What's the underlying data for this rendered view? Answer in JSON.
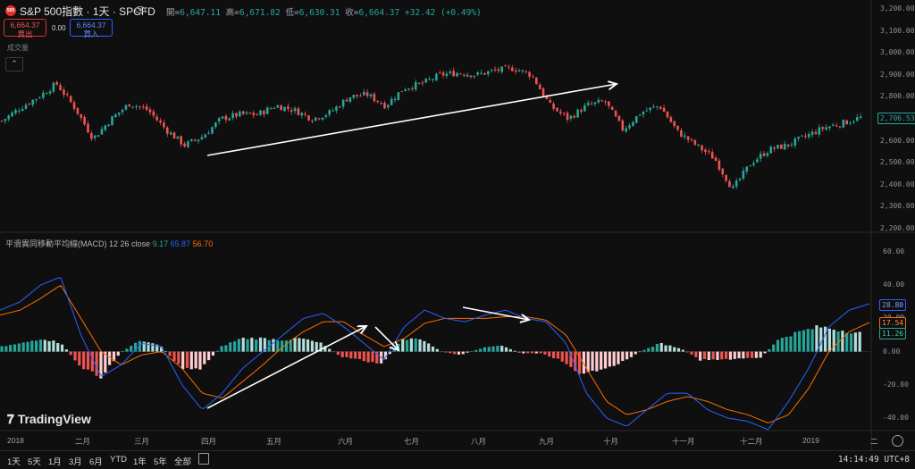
{
  "header": {
    "symbol_badge": "500",
    "title": "S&P 500指數 · 1天 · SPCFD",
    "open_label": "開=",
    "open": "6,647.11",
    "high_label": "高=",
    "high": "6,671.82",
    "low_label": "低=",
    "low": "6,630.31",
    "close_label": "收=",
    "close": "6,664.37",
    "change": "+32.42 (+0.49%)",
    "eye_icon": "eye-icon"
  },
  "trade": {
    "sell_price": "6,664.37",
    "sell_label": "賣出",
    "spread": "0.00",
    "buy_price": "6,664.37",
    "buy_label": "買入"
  },
  "volume_label": "成交量",
  "collapse_icon": "chevron-up-icon",
  "macd": {
    "title": "平滑異同移動平均線(MACD)",
    "params": "12 26 close",
    "hist_value": "9.17",
    "macd_value": "65.87",
    "signal_value": "56.70"
  },
  "price_axis": [
    "3,200.00",
    "3,100.00",
    "3,000.00",
    "2,900.00",
    "2,800.00",
    "2,700.00",
    "2,600.00",
    "2,500.00",
    "2,400.00",
    "2,300.00",
    "2,200.00"
  ],
  "last_price_tag": "2,706.53",
  "macd_axis": [
    "60.00",
    "40.00",
    "20.00",
    "0.00",
    "-20.00",
    "-40.00"
  ],
  "macd_tags": {
    "macd": "28.80",
    "signal": "17.54",
    "hist": "11.26"
  },
  "time_axis": [
    "2018",
    "二月",
    "三月",
    "四月",
    "五月",
    "六月",
    "七月",
    "八月",
    "九月",
    "十月",
    "十一月",
    "十二月",
    "2019",
    "二"
  ],
  "timeframes": [
    "1天",
    "5天",
    "1月",
    "3月",
    "6月",
    "YTD",
    "1年",
    "5年",
    "全部"
  ],
  "clock": "14:14:49 UTC+8",
  "logo_text": "TradingView",
  "colors": {
    "up": "#26a69a",
    "down": "#ef5350",
    "macd": "#2962ff",
    "signal": "#ff6d00",
    "arrow": "#ffffff"
  },
  "chart_data": [
    {
      "type": "candlestick",
      "title": "S&P 500指數 · 1天 · SPCFD",
      "ylim": [
        2200,
        3200
      ],
      "x": [
        "2018-01",
        "2018-02",
        "2018-03",
        "2018-04",
        "2018-05",
        "2018-06",
        "2018-07",
        "2018-08",
        "2018-09",
        "2018-10",
        "2018-11",
        "2018-12",
        "2019-01",
        "2019-02"
      ],
      "close_path": [
        2690,
        2750,
        2800,
        2860,
        2750,
        2610,
        2700,
        2770,
        2740,
        2650,
        2580,
        2620,
        2700,
        2720,
        2720,
        2760,
        2740,
        2700,
        2730,
        2800,
        2810,
        2760,
        2840,
        2860,
        2900,
        2910,
        2900,
        2920,
        2930,
        2900,
        2760,
        2700,
        2760,
        2780,
        2650,
        2730,
        2760,
        2640,
        2580,
        2520,
        2380,
        2500,
        2560,
        2580,
        2620,
        2660,
        2680,
        2706
      ],
      "last_price": 2706.53
    },
    {
      "type": "line",
      "title": "平滑異同移動平均線(MACD)",
      "ylim": [
        -50,
        68
      ],
      "series": [
        {
          "name": "MACD",
          "values": [
            25,
            30,
            40,
            45,
            10,
            -15,
            -8,
            5,
            3,
            -20,
            -35,
            -25,
            -10,
            0,
            10,
            20,
            23,
            15,
            5,
            -5,
            15,
            25,
            20,
            18,
            22,
            25,
            20,
            18,
            5,
            -25,
            -40,
            -45,
            -35,
            -25,
            -25,
            -35,
            -40,
            -42,
            -47,
            -30,
            -10,
            15,
            25,
            28.8
          ]
        },
        {
          "name": "Signal",
          "values": [
            22,
            25,
            32,
            40,
            20,
            0,
            -8,
            -2,
            0,
            -10,
            -25,
            -28,
            -18,
            -8,
            3,
            12,
            18,
            18,
            10,
            3,
            8,
            17,
            20,
            20,
            20,
            21,
            21,
            19,
            10,
            -10,
            -30,
            -38,
            -35,
            -30,
            -27,
            -30,
            -35,
            -38,
            -43,
            -38,
            -22,
            0,
            12,
            17.54
          ]
        },
        {
          "name": "Histogram",
          "values": [
            3,
            5,
            8,
            5,
            -10,
            -15,
            0,
            7,
            3,
            -10,
            -10,
            3,
            8,
            8,
            7,
            8,
            5,
            -3,
            -5,
            -8,
            7,
            8,
            0,
            -2,
            2,
            4,
            -1,
            -1,
            -5,
            -15,
            -10,
            -7,
            0,
            5,
            2,
            -5,
            -5,
            -4,
            -4,
            8,
            12,
            15,
            13,
            11.26
          ]
        }
      ]
    }
  ]
}
